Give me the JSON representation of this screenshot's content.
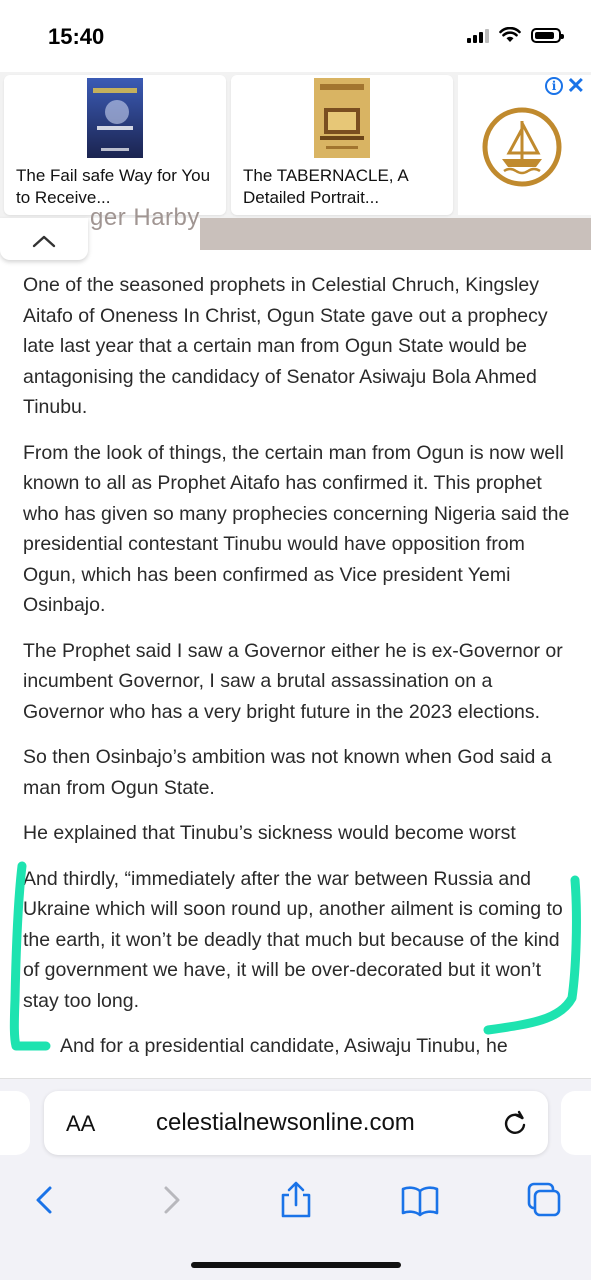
{
  "status_bar": {
    "time": "15:40"
  },
  "ads": {
    "items": [
      {
        "title": "The Fail safe Way for You to Receive...",
        "cover_color": "#2a3f8a"
      },
      {
        "title": "The TABERNACLE, A Detailed Portrait...",
        "cover_color": "#c9a24a"
      }
    ],
    "brand_color": "#c08a2e",
    "info_label": "i",
    "close_label": "✕"
  },
  "article": {
    "byline_partial": "ger Harby",
    "paragraphs": [
      "One of the seasoned prophets in Celestial Chruch, Kingsley Aitafo of Oneness In Christ, Ogun State gave out a prophecy late last year that a certain man from Ogun State would be antagonising the candidacy of Senator Asiwaju Bola Ahmed Tinubu.",
      "From the look of things, the certain man from Ogun is now well known to all as Prophet Aitafo has confirmed it. This prophet who has given so many prophecies concerning Nigeria said the presidential contestant Tinubu would have opposition from Ogun, which has been confirmed as Vice president Yemi Osinbajo.",
      "The Prophet said I saw a Governor either he is ex-Governor or incumbent Governor, I saw a brutal assassination on a Governor who has a very bright future in the 2023 elections.",
      "So then Osinbajo’s ambition was not known when God said a man from Ogun State.",
      "He explained that Tinubu’s sickness would become worst",
      "And thirdly, “immediately after the war between Russia and Ukraine which will soon round up, another ailment is coming to the earth, it won’t be deadly that much but because of the kind of government we have, it will be over-decorated but it won’t stay too long."
    ],
    "cut_line": "And for a presidential candidate, Asiwaju Tinubu, he"
  },
  "highlight_color": "#1ee3b0",
  "browser": {
    "text_size_label": "AA",
    "url": "celestialnewsonline.com"
  },
  "accent_color": "#1a73e8"
}
